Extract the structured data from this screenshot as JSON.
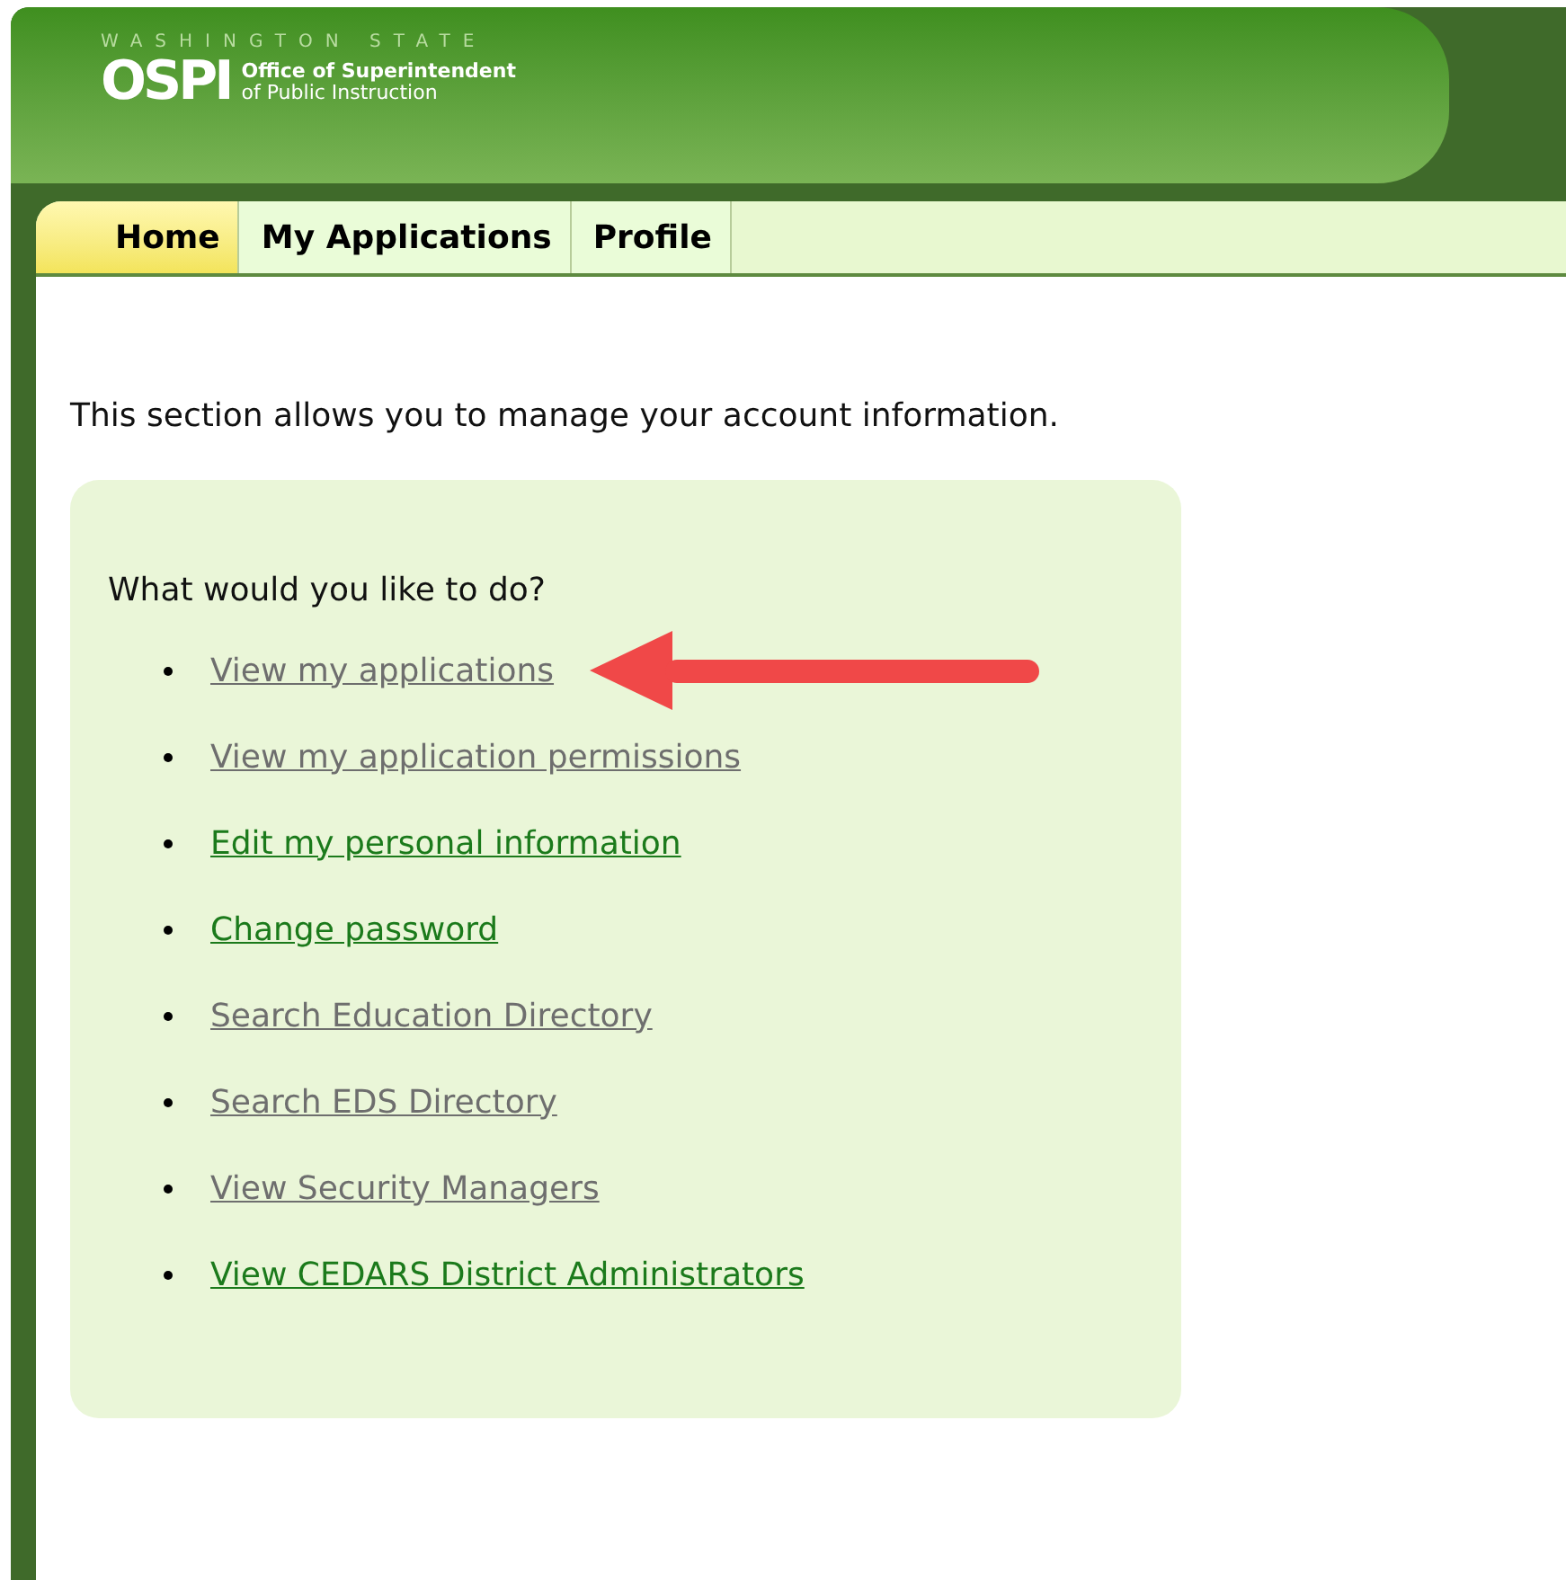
{
  "header": {
    "state_line": "WASHINGTON STATE",
    "logo": "OSPI",
    "org_line_1": "Office of Superintendent",
    "org_line_2": "of Public Instruction"
  },
  "tabs": [
    {
      "label": "Home",
      "selected": true
    },
    {
      "label": "My Applications",
      "selected": false
    },
    {
      "label": "Profile",
      "selected": false
    }
  ],
  "intro": "This section allows you to manage your account information.",
  "panel": {
    "question": "What would you like to do?",
    "links": [
      {
        "label": "View my applications",
        "visited": true,
        "arrow": true
      },
      {
        "label": "View my application permissions",
        "visited": true,
        "arrow": false
      },
      {
        "label": "Edit my personal information",
        "visited": false,
        "arrow": false
      },
      {
        "label": "Change password",
        "visited": false,
        "arrow": false
      },
      {
        "label": "Search Education Directory",
        "visited": true,
        "arrow": false
      },
      {
        "label": "Search EDS Directory",
        "visited": true,
        "arrow": false
      },
      {
        "label": "View Security Managers",
        "visited": true,
        "arrow": false
      },
      {
        "label": "View CEDARS District Administrators",
        "visited": false,
        "arrow": false
      }
    ]
  }
}
